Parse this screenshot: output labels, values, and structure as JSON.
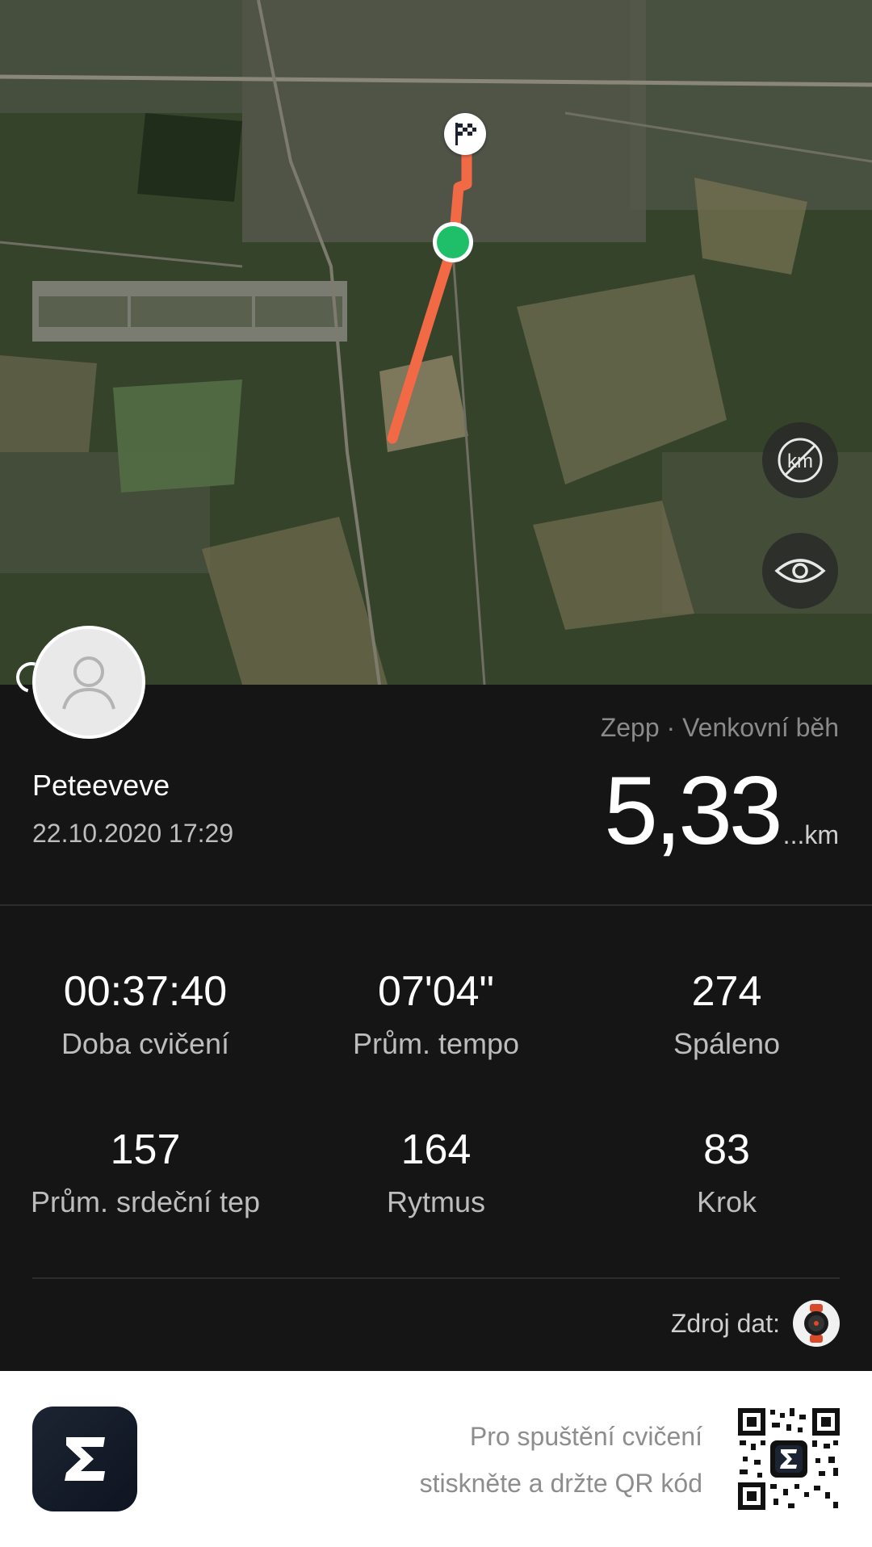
{
  "map": {
    "start_marker_icon": "green-dot-icon",
    "finish_marker_icon": "checkered-flag-icon",
    "route_color": "#f26a45",
    "buttons": [
      {
        "icon": "km-marker-toggle-icon"
      },
      {
        "icon": "eye-icon"
      }
    ]
  },
  "profile": {
    "username": "Peteeveve",
    "datetime": "22.10.2020 17:29",
    "avatar_icon": "user-avatar-icon"
  },
  "workout": {
    "source": "Zepp · Venkovní běh",
    "distance": "5,33",
    "distance_unit": "...km"
  },
  "stats": [
    {
      "value": "00:37:40",
      "label": "Doba cvičení"
    },
    {
      "value": "07'04\"",
      "label": "Prům. tempo"
    },
    {
      "value": "274",
      "label": "Spáleno"
    },
    {
      "value": "157",
      "label": "Prům. srdeční tep"
    },
    {
      "value": "164",
      "label": "Rytmus"
    },
    {
      "value": "83",
      "label": "Krok"
    }
  ],
  "data_source": {
    "label": "Zdroj dat:",
    "icon": "watch-icon"
  },
  "footer": {
    "app_icon": "zepp-sigma-icon",
    "text_line1": "Pro spuštění cvičení",
    "text_line2": "stiskněte a držte QR kód",
    "qr_icon": "qr-code-icon"
  }
}
